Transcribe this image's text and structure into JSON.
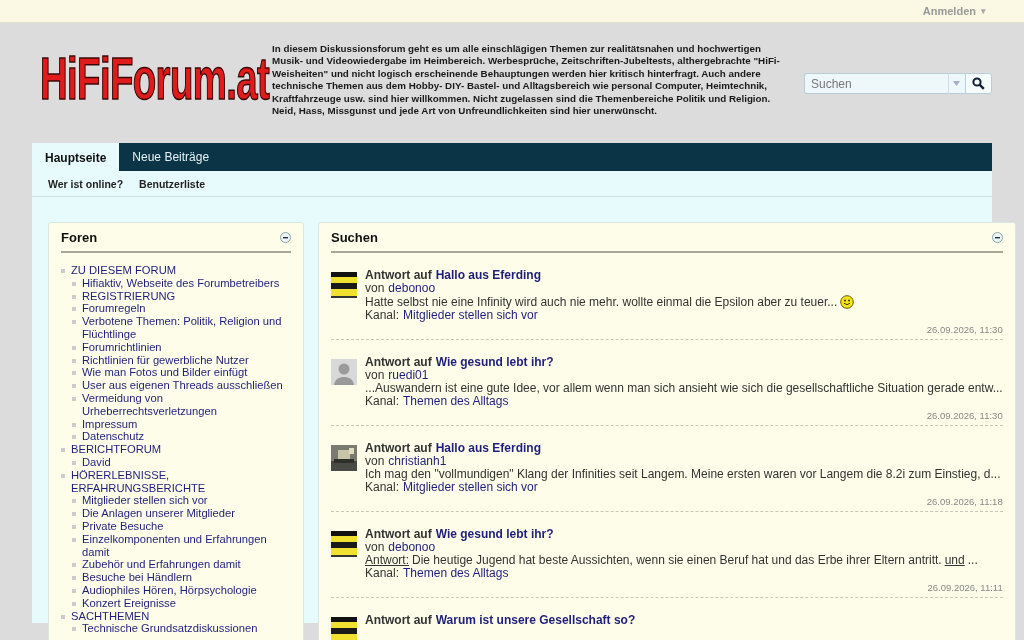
{
  "topbar": {
    "login": "Anmelden",
    "login_caret": "▾"
  },
  "header": {
    "logo": "HiFiForum.at",
    "description": "In diesem Diskussionsforum geht es um alle einschlägigen Themen zur realitätsnahen und hochwertigen Musik- und Videowiedergabe im Heimbereich. Werbesprüche, Zeitschriften-Jubeltests, althergebrachte \"HiFi-Weisheiten\" und nicht logisch erscheinende Behauptungen werden hier kritisch hinterfragt. Auch andere technische Themen aus dem Hobby- DIY- Bastel- und Alltagsbereich wie personal Computer, Heimtechnik, Kraftfahrzeuge usw. sind hier willkommen. Nicht zugelassen sind die Themenbereiche Politik und Religion. Neid, Hass, Missgunst und jede Art von Unfreundlichkeiten sind hier unerwünscht.",
    "search": {
      "placeholder": "Suchen"
    }
  },
  "nav": {
    "tabs": [
      {
        "label": "Hauptseite",
        "selected": true
      },
      {
        "label": "Neue Beiträge",
        "selected": false
      }
    ],
    "sub_links": [
      "Wer ist online?",
      "Benutzerliste"
    ]
  },
  "forums": {
    "title": "Foren",
    "items": [
      {
        "label": "ZU DIESEM FORUM",
        "children": [
          {
            "label": "Hifiaktiv, Webseite des Forumbetreibers"
          },
          {
            "label": "REGISTRIERUNG"
          },
          {
            "label": "Forumregeln"
          },
          {
            "label": "Verbotene Themen: Politik, Religion und Flüchtlinge"
          },
          {
            "label": "Forumrichtlinien"
          },
          {
            "label": "Richtlinien für gewerbliche Nutzer"
          },
          {
            "label": "Wie man Fotos und Bilder einfügt"
          },
          {
            "label": "User aus eigenen Threads ausschließen"
          },
          {
            "label": "Vermeidung von Urheberrechtsverletzungen"
          },
          {
            "label": "Impressum"
          },
          {
            "label": "Datenschutz"
          }
        ]
      },
      {
        "label": "BERICHTFORUM",
        "children": [
          {
            "label": "David"
          }
        ]
      },
      {
        "label": "HÖRERLEBNISSE, ERFAHRUNGSBERICHTE",
        "children": [
          {
            "label": "Mitglieder stellen sich vor"
          },
          {
            "label": "Die Anlagen unserer Mitglieder"
          },
          {
            "label": "Private Besuche"
          },
          {
            "label": "Einzelkomponenten und Erfahrungen damit"
          },
          {
            "label": "Zubehör und Erfahrungen damit"
          },
          {
            "label": "Besuche bei Händlern"
          },
          {
            "label": "Audiophiles Hören, Hörpsychologie"
          },
          {
            "label": "Konzert Ereignisse"
          }
        ]
      },
      {
        "label": "SACHTHEMEN",
        "children": [
          {
            "label": "Technische Grundsatzdiskussionen"
          }
        ]
      }
    ]
  },
  "search_panel": {
    "title": "Suchen",
    "posts": [
      {
        "avatar": {
          "kind": "stripes"
        },
        "prefix": "Antwort auf",
        "thread": "Hallo aus Eferding",
        "by": "von",
        "user": "debonoo",
        "excerpt": [
          {
            "text": "Hatte selbst nie eine Infinity wird auch nie mehr. wollte einmal die Epsilon aber zu teuer...",
            "underline": false
          }
        ],
        "smiley": true,
        "channel_label": "Kanal:",
        "channel": "Mitglieder stellen sich vor",
        "time": "26.09.2026, 11:30"
      },
      {
        "avatar": {
          "kind": "silhouette"
        },
        "prefix": "Antwort auf",
        "thread": "Wie gesund lebt ihr?",
        "by": "von",
        "user": "ruedi01",
        "excerpt": [
          {
            "text": "...Auswandern ist eine gute Idee, vor allem wenn man sich ansieht wie sich die gesellschaftliche Situation gerade entw...",
            "underline": false
          }
        ],
        "smiley": false,
        "channel_label": "Kanal:",
        "channel": "Themen des Alltags",
        "time": "26.09.2026, 11:30"
      },
      {
        "avatar": {
          "kind": "picture"
        },
        "prefix": "Antwort auf",
        "thread": "Hallo aus Eferding",
        "by": "von",
        "user": "christianh1",
        "excerpt": [
          {
            "text": "Ich mag den \"vollmundigen\" Klang der Infinities seit Langem. Meine ersten waren vor Langem die 8.2i zum Einstieg, d...",
            "underline": false
          }
        ],
        "smiley": false,
        "channel_label": "Kanal:",
        "channel": "Mitglieder stellen sich vor",
        "time": "26.09.2026, 11:18"
      },
      {
        "avatar": {
          "kind": "stripes"
        },
        "prefix": "Antwort auf",
        "thread": "Wie gesund lebt ihr?",
        "by": "von",
        "user": "debonoo",
        "excerpt": [
          {
            "text": "Antwort:",
            "underline": true
          },
          {
            "text": "Die heutige Jugend hat beste Aussichten, wenn sie einen Beruf hat und das Erbe ihrer Eltern antritt.",
            "underline": false
          },
          {
            "text": "und",
            "underline": true
          },
          {
            "text": "...",
            "underline": false
          }
        ],
        "smiley": false,
        "channel_label": "Kanal:",
        "channel": "Themen des Alltags",
        "time": "26.09.2026, 11:11"
      },
      {
        "avatar": {
          "kind": "stripes"
        },
        "prefix": "Antwort auf",
        "thread": "Warum ist unsere Gesellschaft so?"
      }
    ]
  }
}
